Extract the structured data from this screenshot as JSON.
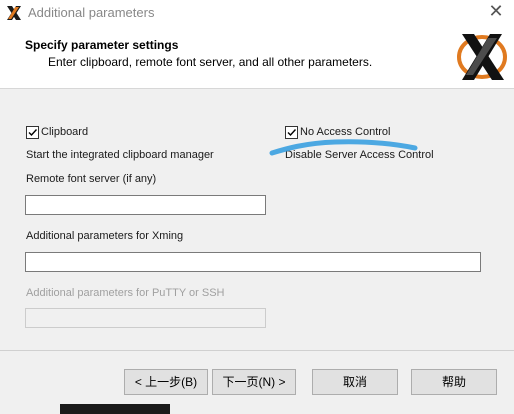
{
  "window": {
    "title": "Additional parameters"
  },
  "header": {
    "title": "Specify parameter settings",
    "subtitle": "Enter clipboard, remote font server, and all other parameters."
  },
  "options": {
    "clipboard": {
      "label": "Clipboard",
      "checked": true,
      "description": "Start the integrated clipboard manager"
    },
    "no_access_control": {
      "label": "No Access Control",
      "checked": true,
      "description": "Disable Server Access Control"
    }
  },
  "fields": {
    "remote_font_server": {
      "label": "Remote font server (if any)",
      "value": ""
    },
    "xming_params": {
      "label": "Additional parameters for Xming",
      "value": ""
    },
    "putty_params": {
      "label": "Additional parameters for PuTTY or SSH",
      "value": "",
      "disabled": true
    }
  },
  "buttons": {
    "back": "< 上一步(B)",
    "next": "下一页(N) >",
    "cancel": "取消",
    "help": "帮助"
  },
  "colors": {
    "annotation_stroke": "#3aa0e0"
  },
  "icons": {
    "app": "xming-x-icon",
    "logo": "xming-logo",
    "close": "close-icon"
  }
}
